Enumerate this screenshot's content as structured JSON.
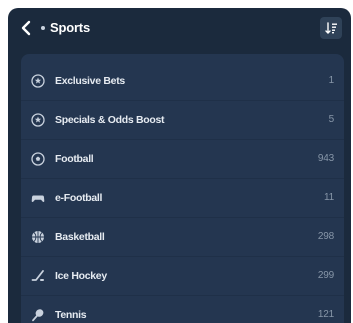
{
  "header": {
    "title": "Sports",
    "back_icon": "chevron-left-icon",
    "sort_icon": "sort-icon"
  },
  "sports": [
    {
      "label": "Exclusive Bets",
      "count": "1",
      "icon": "star-badge-icon"
    },
    {
      "label": "Specials & Odds Boost",
      "count": "5",
      "icon": "star-badge-icon"
    },
    {
      "label": "Football",
      "count": "943",
      "icon": "soccer-ball-icon"
    },
    {
      "label": "e-Football",
      "count": "11",
      "icon": "gamepad-icon"
    },
    {
      "label": "Basketball",
      "count": "298",
      "icon": "basketball-icon"
    },
    {
      "label": "Ice Hockey",
      "count": "299",
      "icon": "hockey-stick-icon"
    },
    {
      "label": "Tennis",
      "count": "121",
      "icon": "tennis-racket-icon"
    }
  ],
  "colors": {
    "panel_bg": "#1b2a3d",
    "list_bg": "#243650",
    "label_text": "#e6ebf1",
    "count_text": "#8796a8"
  }
}
